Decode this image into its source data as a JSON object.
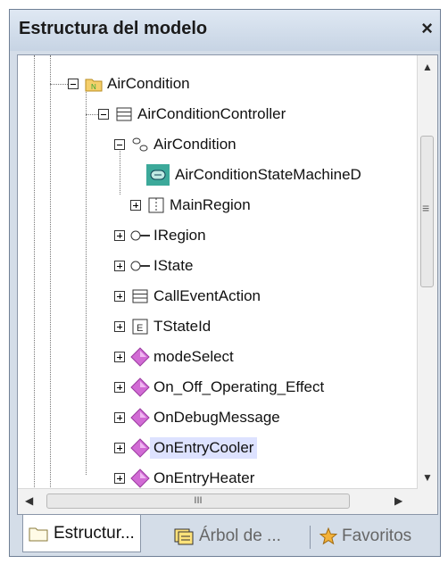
{
  "panel": {
    "title": "Estructura del modelo",
    "close_glyph": "×"
  },
  "tree": {
    "items": [
      {
        "label": "AirCondition",
        "icon": "package-icon"
      },
      {
        "label": "AirConditionController",
        "icon": "class-icon"
      },
      {
        "label": "AirCondition",
        "icon": "state-machine-icon"
      },
      {
        "label": "AirConditionStateMachineD",
        "icon": "diagram-icon"
      },
      {
        "label": "MainRegion",
        "icon": "region-icon"
      },
      {
        "label": "IRegion",
        "icon": "interface-icon"
      },
      {
        "label": "IState",
        "icon": "interface-icon"
      },
      {
        "label": "CallEventAction",
        "icon": "class-icon"
      },
      {
        "label": "TStateId",
        "icon": "enumeration-icon"
      },
      {
        "label": "modeSelect",
        "icon": "signal-icon"
      },
      {
        "label": "On_Off_Operating_Effect",
        "icon": "signal-icon"
      },
      {
        "label": "OnDebugMessage",
        "icon": "signal-icon"
      },
      {
        "label": "OnEntryCooler",
        "icon": "signal-icon",
        "selected": true
      },
      {
        "label": "OnEntryHeater",
        "icon": "signal-icon"
      }
    ]
  },
  "scroll": {
    "hthumb_glyph": "III",
    "vthumb_glyph": "≡"
  },
  "tabs": [
    {
      "label": "Estructur...",
      "icon": "folder-icon",
      "active": true
    },
    {
      "label": "Árbol de ...",
      "icon": "tree-icon",
      "active": false
    },
    {
      "label": "Favoritos",
      "icon": "star-icon",
      "active": false
    }
  ],
  "colors": {
    "accent": "#c7d4e4",
    "selection": "#dde2ff",
    "signal": "#d16bd4"
  }
}
